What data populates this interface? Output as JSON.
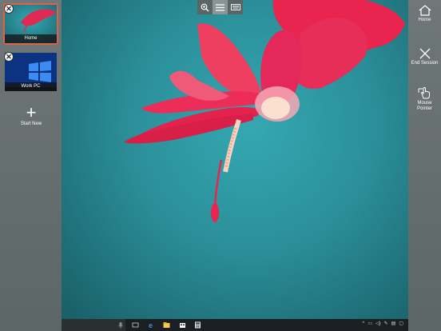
{
  "sessions": [
    {
      "label": "Home",
      "active": true
    },
    {
      "label": "Work PC",
      "active": false
    }
  ],
  "start_new": {
    "label": "Start New"
  },
  "right_panel": {
    "home": "Home",
    "end_session": "End Session",
    "mouse_pointer_line1": "Mouse",
    "mouse_pointer_line2": "Pointer"
  },
  "icons": {
    "close": "close-icon",
    "zoom": "zoom-icon",
    "menu": "menu-icon",
    "keyboard": "keyboard-icon"
  },
  "colors": {
    "active_outline": "#e0614a",
    "teal": "#2b8f99",
    "flower": "#e8244f"
  }
}
